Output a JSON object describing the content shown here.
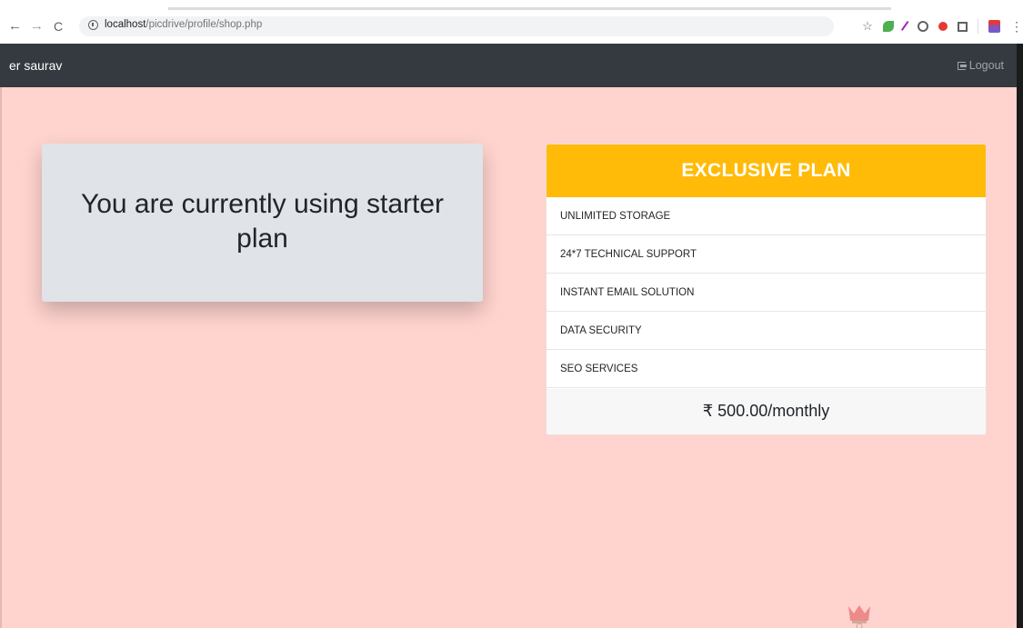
{
  "browser": {
    "url_host": "localhost",
    "url_path": "/picdrive/profile/shop.php",
    "icons": [
      "back-icon",
      "forward-icon",
      "reload-icon",
      "info-icon",
      "star-icon",
      "menu-icon"
    ],
    "back_glyph": "←",
    "forward_glyph": "→",
    "reload_glyph": "C",
    "star_glyph": "☆",
    "menu_glyph": "⋮"
  },
  "navbar": {
    "brand": "er saurav",
    "logout_label": "Logout",
    "background": "#343a40"
  },
  "current_plan": {
    "message": "You are currently using starter plan"
  },
  "plan": {
    "title": "EXCLUSIVE PLAN",
    "header_color": "#ffbb07",
    "features": [
      "UNLIMITED STORAGE",
      "24*7 TECHNICAL SUPPORT",
      "INSTANT EMAIL SOLUTION",
      "DATA SECURITY",
      "SEO SERVICES"
    ],
    "price": "₹ 500.00/monthly"
  },
  "page": {
    "background": "#ffd3ce"
  }
}
